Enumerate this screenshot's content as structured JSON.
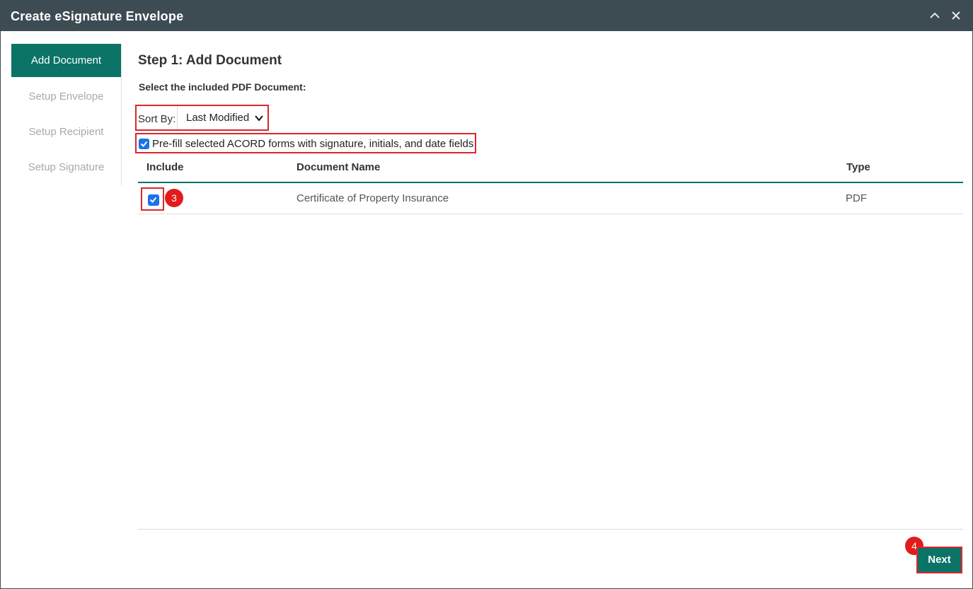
{
  "window": {
    "title": "Create eSignature Envelope",
    "titlebar_icons": [
      "chevron-up-icon",
      "close-icon"
    ]
  },
  "sidebar": {
    "items": [
      {
        "label": "Add Document",
        "active": true
      },
      {
        "label": "Setup Envelope",
        "active": false
      },
      {
        "label": "Setup Recipient",
        "active": false
      },
      {
        "label": "Setup Signature",
        "active": false
      }
    ]
  },
  "main": {
    "step_title": "Step 1: Add Document",
    "subtitle": "Select the included PDF Document:",
    "sort": {
      "label": "Sort By:",
      "value": "Last Modified"
    },
    "prefill": {
      "label": "Pre-fill selected ACORD forms with signature, initials, and date fields",
      "checked": true
    },
    "table": {
      "headers": {
        "include": "Include",
        "name": "Document Name",
        "type": "Type"
      },
      "rows": [
        {
          "include": true,
          "name": "Certificate of Property Insurance",
          "type": "PDF"
        }
      ]
    },
    "next_label": "Next"
  },
  "annotations": {
    "step3": "3",
    "step4": "4"
  },
  "colors": {
    "accent": "#0b7466",
    "titlebar": "#3d4b53",
    "highlight": "#d9272e",
    "checkbox": "#1a73e8",
    "badge": "#e21b1b"
  }
}
